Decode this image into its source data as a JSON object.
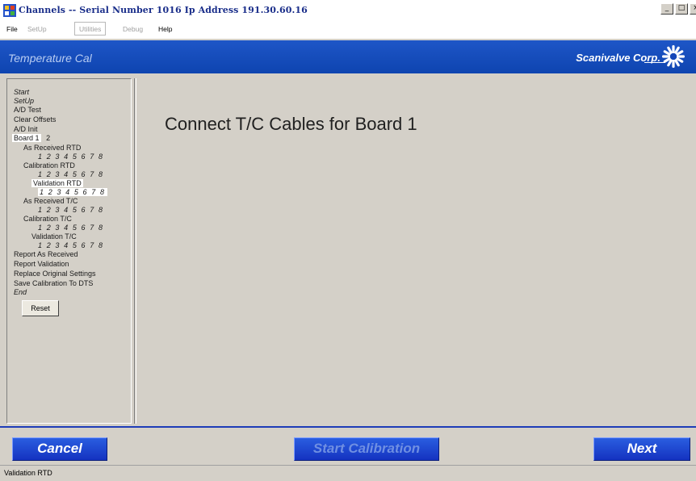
{
  "window": {
    "title": "Channels -- Serial Number 1016 Ip Address 191.30.60.16",
    "controls": [
      "_",
      "□",
      "×"
    ]
  },
  "menu": {
    "file": "File",
    "setup": "SetUp",
    "utilities": "Utilities",
    "debug": "Debug",
    "help": "Help"
  },
  "banner": {
    "title": "Temperature Cal",
    "brand": "Scanivalve Corp."
  },
  "sidebar": {
    "start": "Start",
    "setup": "SetUp",
    "ad_test": "A/D Test",
    "clear_offsets": "Clear Offsets",
    "ad_init": "A/D Init",
    "board_label": "Board",
    "board_1": "1",
    "board_2": "2",
    "as_received_rtd": "As Received RTD",
    "calibration_rtd": "Calibration RTD",
    "validation_rtd": "Validation RTD",
    "as_received_tc": "As Received T/C",
    "calibration_tc": "Calibration T/C",
    "validation_tc": "Validation T/C",
    "channels": "1 2 3 4 5 6 7 8",
    "report_as_received": "Report As Received",
    "report_validation": "Report Validation",
    "replace_original": "Replace Original Settings",
    "save_calibration": "Save Calibration To DTS",
    "end": "End",
    "reset": "Reset"
  },
  "main": {
    "instruction": "Connect T/C Cables for Board 1"
  },
  "buttons": {
    "cancel": "Cancel",
    "start_calibration": "Start Calibration",
    "next": "Next"
  },
  "status": {
    "text": "Validation RTD"
  },
  "colors": {
    "banner": "#1446b8",
    "button": "#1e46d0",
    "face": "#d4d0c8"
  }
}
